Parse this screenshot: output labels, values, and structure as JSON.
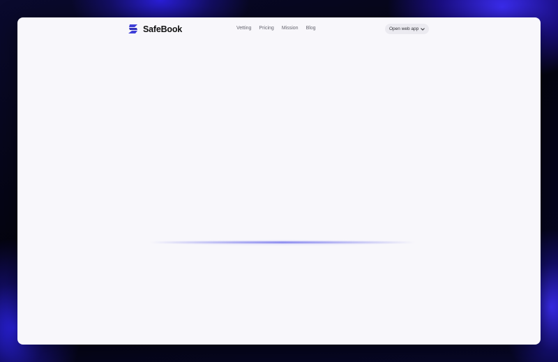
{
  "brand": {
    "name": "SafeBook",
    "logo_icon": "safebook-logo-icon",
    "accent_color": "#3f3fd8"
  },
  "nav": {
    "links": [
      {
        "label": "Vetting"
      },
      {
        "label": "Pricing"
      },
      {
        "label": "Mission"
      },
      {
        "label": "Blog"
      }
    ],
    "cta_label": "Open web app",
    "cta_icon": "chevron-down-icon"
  }
}
